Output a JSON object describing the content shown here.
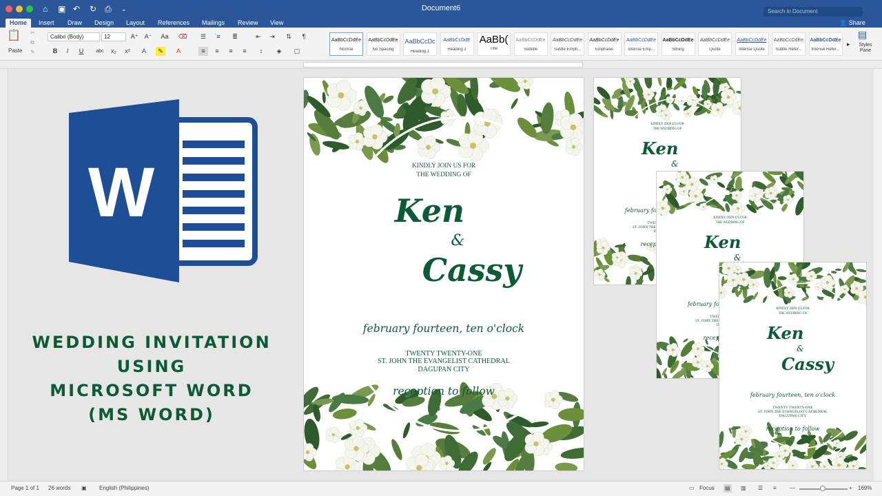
{
  "window": {
    "title": "Document6"
  },
  "search": {
    "placeholder": "Search in Document"
  },
  "tabs": [
    {
      "label": "Home"
    },
    {
      "label": "Insert"
    },
    {
      "label": "Draw"
    },
    {
      "label": "Design"
    },
    {
      "label": "Layout"
    },
    {
      "label": "References"
    },
    {
      "label": "Mailings"
    },
    {
      "label": "Review"
    },
    {
      "label": "View"
    }
  ],
  "share_label": "Share",
  "ribbon": {
    "paste_label": "Paste",
    "font_name": "Calibri (Body)",
    "font_size": "12",
    "styles": [
      {
        "sample": "AaBbCcDdEe",
        "name": "Normal"
      },
      {
        "sample": "AaBbCcDdEe",
        "name": "No Spacing"
      },
      {
        "sample": "AaBbCcDc",
        "name": "Heading 1"
      },
      {
        "sample": "AaBbCcDdE",
        "name": "Heading 2"
      },
      {
        "sample": "AaBb(",
        "name": "Title"
      },
      {
        "sample": "AaBbCcDdEe",
        "name": "Subtitle"
      },
      {
        "sample": "AaBbCcDdEe",
        "name": "Subtle Emph..."
      },
      {
        "sample": "AaBbCcDdEe",
        "name": "Emphasis"
      },
      {
        "sample": "AaBbCcDdEe",
        "name": "Intense Emp..."
      },
      {
        "sample": "AaBbCcDdEe",
        "name": "Strong"
      },
      {
        "sample": "AaBbCcDdEe",
        "name": "Quote"
      },
      {
        "sample": "AaBbCcDdEe",
        "name": "Intense Quote"
      },
      {
        "sample": "AaBbCcDdEe",
        "name": "Subtle Refer..."
      },
      {
        "sample": "AaBbCcDdEe",
        "name": "Intense Refer..."
      }
    ],
    "styles_pane_label": "Styles Pane"
  },
  "headline": [
    "WEDDING INVITATION",
    "USING",
    "MICROSOFT WORD",
    "(MS WORD)"
  ],
  "invitation": {
    "line1": "KINDLY JOIN US FOR",
    "line2": "THE WEDDING OF",
    "name1": "Ken",
    "amp": "&",
    "name2": "Cassy",
    "date": "february fourteen, ten o'clock",
    "year": "TWENTY TWENTY-ONE",
    "venue": "ST. JOHN THE EVANGELIST CATHEDRAL",
    "city": "DAGUPAN CITY",
    "reception": "reception to follow"
  },
  "status": {
    "page": "Page 1 of 1",
    "words": "26 words",
    "language": "English (Philippines)",
    "focus": "Focus",
    "zoom": "169%"
  },
  "colors": {
    "word_blue": "#2b579a",
    "invite_green": "#0d5a36"
  }
}
